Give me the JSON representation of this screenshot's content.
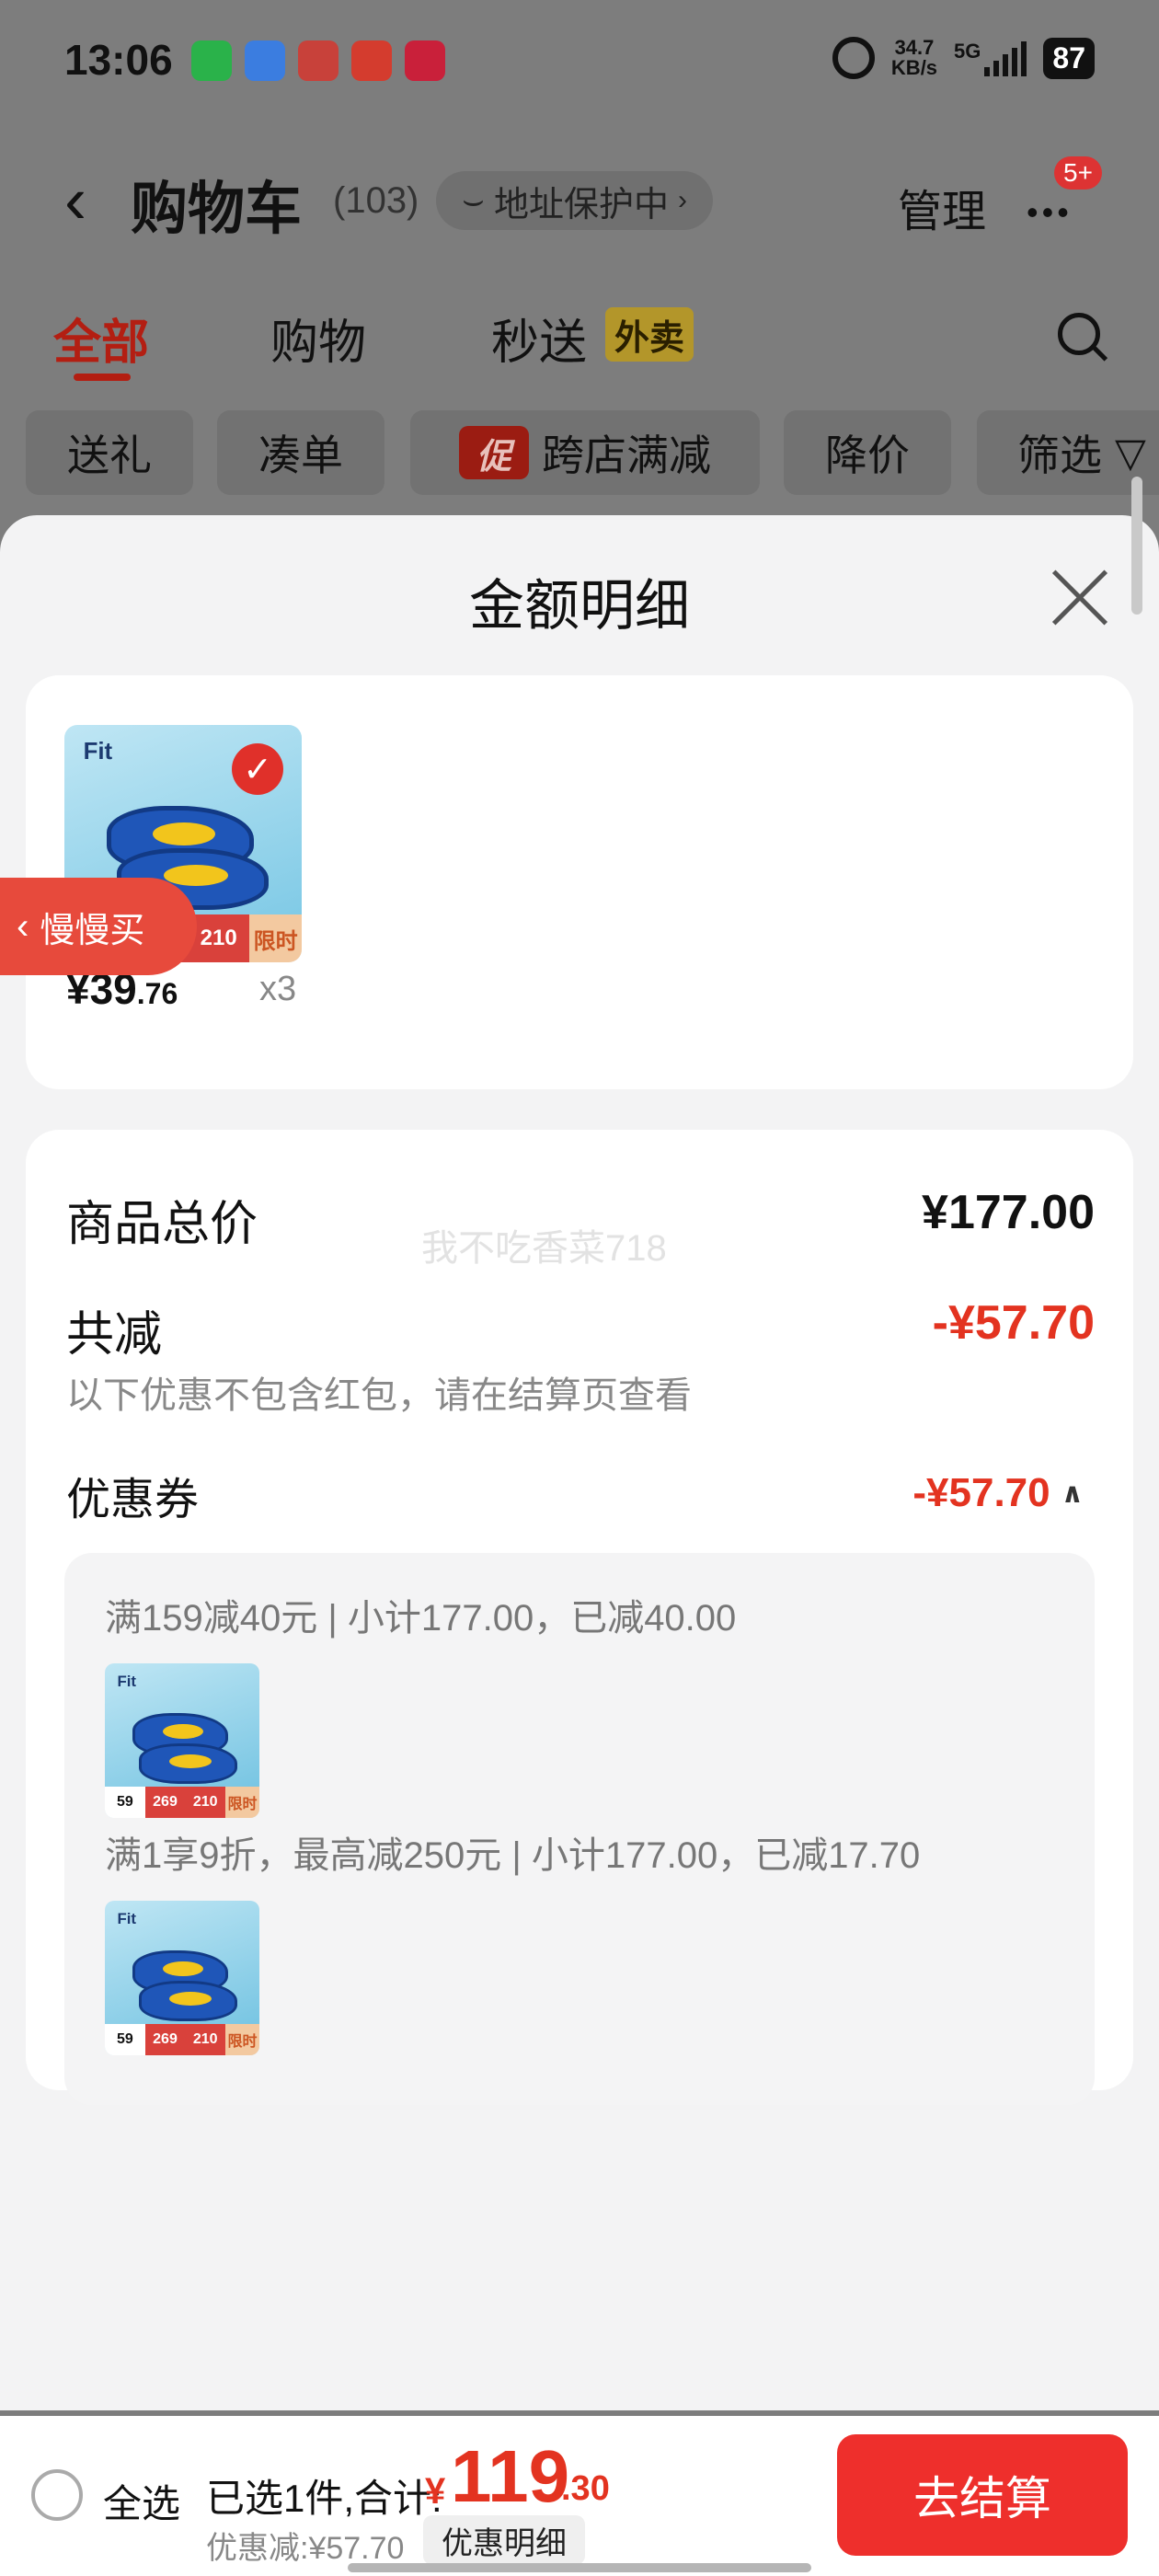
{
  "status_bar": {
    "time": "13:06",
    "net_speed_value": "34.7",
    "net_speed_unit": "KB/s",
    "network": "5G",
    "battery": "87"
  },
  "nav": {
    "title": "购物车",
    "count": "(103)",
    "address_protect": "地址保护中",
    "manage": "管理",
    "badge": "5+"
  },
  "tabs": [
    {
      "label": "全部"
    },
    {
      "label": "购物"
    },
    {
      "label": "秒送"
    }
  ],
  "tab_tag": "外卖",
  "chips": [
    {
      "label": "送礼"
    },
    {
      "label": "凑单"
    },
    {
      "label": "跨店满减",
      "tag": "促"
    },
    {
      "label": "降价"
    },
    {
      "label": "筛选"
    }
  ],
  "sheet": {
    "title": "金额明细",
    "side_tab": "慢慢买",
    "product": {
      "price_main": "¥39",
      "price_decimal": ".76",
      "quantity": "x3",
      "thumb_logo": "Fit",
      "thumb_prices": [
        "59",
        "269",
        "210",
        "限时"
      ]
    },
    "watermark": "我不吃香菜718",
    "total_label": "商品总价",
    "total_value": "¥177.00",
    "reduce_label": "共减",
    "reduce_value": "-¥57.70",
    "note": "以下优惠不包含红包，请在结算页查看",
    "coupon_label": "优惠券",
    "coupon_value": "-¥57.70",
    "coupons": [
      {
        "text": "满159减40元 | 小计177.00，已减40.00"
      },
      {
        "text": "满1享9折，最高减250元 | 小计177.00，已减17.70"
      }
    ]
  },
  "bottom_bar": {
    "select_all": "全选",
    "selected_text": "已选1件,合计:",
    "currency": "¥",
    "total_int": "119",
    "total_dec": ".30",
    "discount": "优惠减:¥57.70",
    "detail_button": "优惠明细",
    "checkout": "去结算"
  },
  "colors": {
    "accent_red": "#E33320",
    "checkout_red": "#EE2F2C"
  }
}
